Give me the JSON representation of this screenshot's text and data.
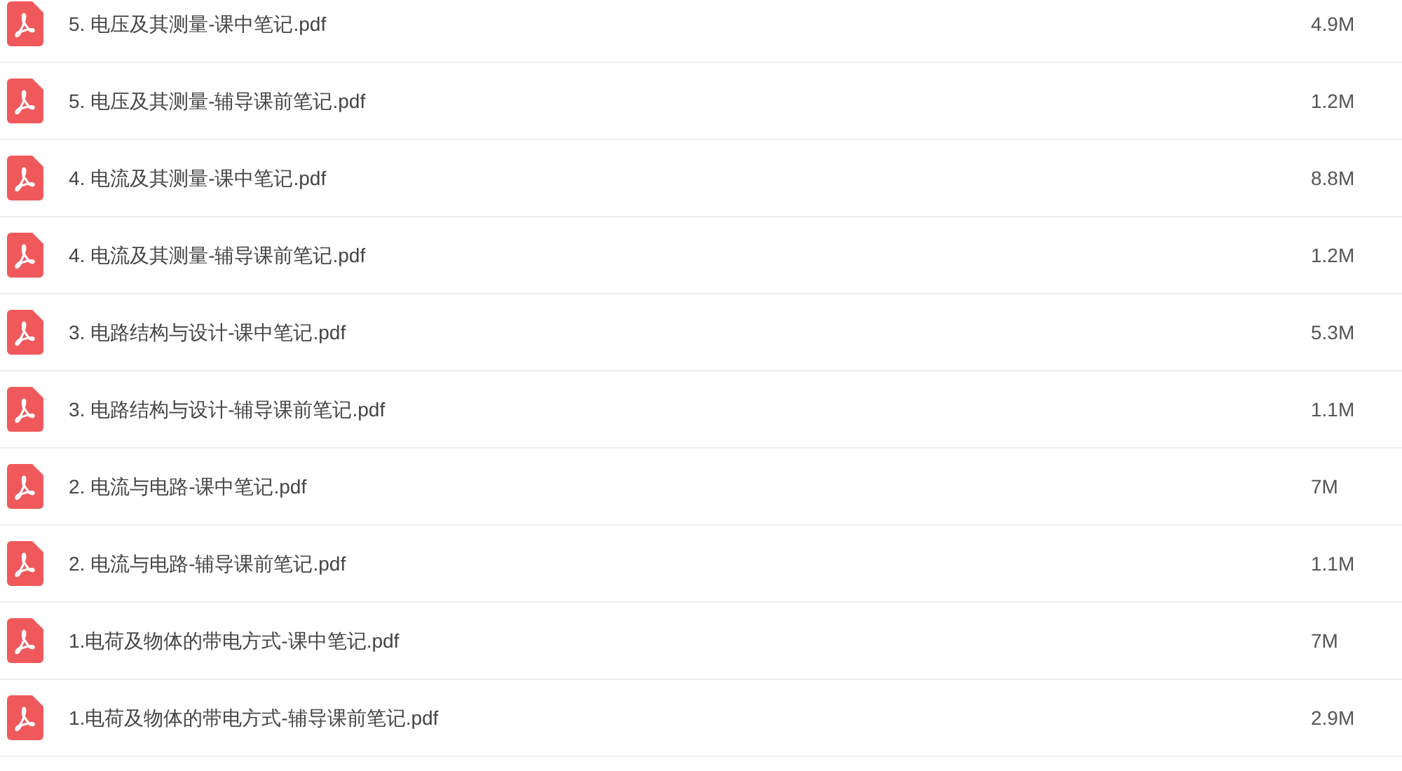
{
  "files": [
    {
      "name": "5. 电压及其测量-课中笔记.pdf",
      "size": "4.9M"
    },
    {
      "name": "5. 电压及其测量-辅导课前笔记.pdf",
      "size": "1.2M"
    },
    {
      "name": "4. 电流及其测量-课中笔记.pdf",
      "size": "8.8M"
    },
    {
      "name": "4. 电流及其测量-辅导课前笔记.pdf",
      "size": "1.2M"
    },
    {
      "name": "3. 电路结构与设计-课中笔记.pdf",
      "size": "5.3M"
    },
    {
      "name": "3. 电路结构与设计-辅导课前笔记.pdf",
      "size": "1.1M"
    },
    {
      "name": "2. 电流与电路-课中笔记.pdf",
      "size": "7M"
    },
    {
      "name": "2. 电流与电路-辅导课前笔记.pdf",
      "size": "1.1M"
    },
    {
      "name": "1.电荷及物体的带电方式-课中笔记.pdf",
      "size": "7M"
    },
    {
      "name": "1.电荷及物体的带电方式-辅导课前笔记.pdf",
      "size": "2.9M"
    }
  ]
}
